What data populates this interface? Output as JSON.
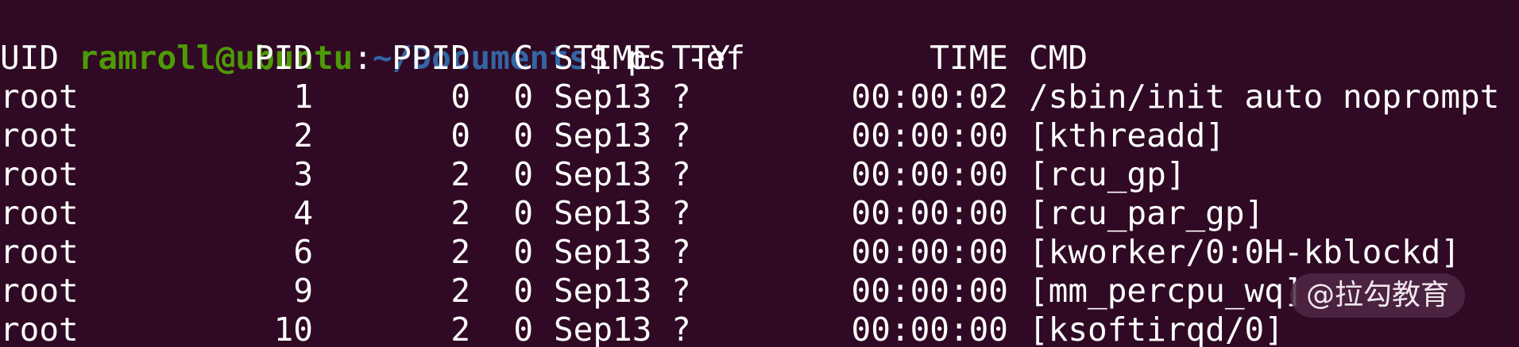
{
  "prompt": {
    "user_host": "ramroll@ubuntu",
    "colon": ":",
    "path": "~/Documents",
    "symbol": "$",
    "command": " ps -ef"
  },
  "table": {
    "headers": [
      "UID",
      "PID",
      "PPID",
      "C",
      "STIME",
      "TTY",
      "TIME",
      "CMD"
    ],
    "rows": [
      [
        "root",
        "1",
        "0",
        "0",
        "Sep13",
        "?",
        "00:00:02",
        "/sbin/init auto noprompt"
      ],
      [
        "root",
        "2",
        "0",
        "0",
        "Sep13",
        "?",
        "00:00:00",
        "[kthreadd]"
      ],
      [
        "root",
        "3",
        "2",
        "0",
        "Sep13",
        "?",
        "00:00:00",
        "[rcu_gp]"
      ],
      [
        "root",
        "4",
        "2",
        "0",
        "Sep13",
        "?",
        "00:00:00",
        "[rcu_par_gp]"
      ],
      [
        "root",
        "6",
        "2",
        "0",
        "Sep13",
        "?",
        "00:00:00",
        "[kworker/0:0H-kblockd]"
      ],
      [
        "root",
        "9",
        "2",
        "0",
        "Sep13",
        "?",
        "00:00:00",
        "[mm_percpu_wq]"
      ],
      [
        "root",
        "10",
        "2",
        "0",
        "Sep13",
        "?",
        "00:00:00",
        "[ksoftirqd/0]"
      ]
    ]
  },
  "watermark": "@拉勾教育",
  "colors": {
    "background": "#300a24",
    "user": "#4e9a06",
    "path": "#3465a4",
    "text": "#ffffff"
  }
}
